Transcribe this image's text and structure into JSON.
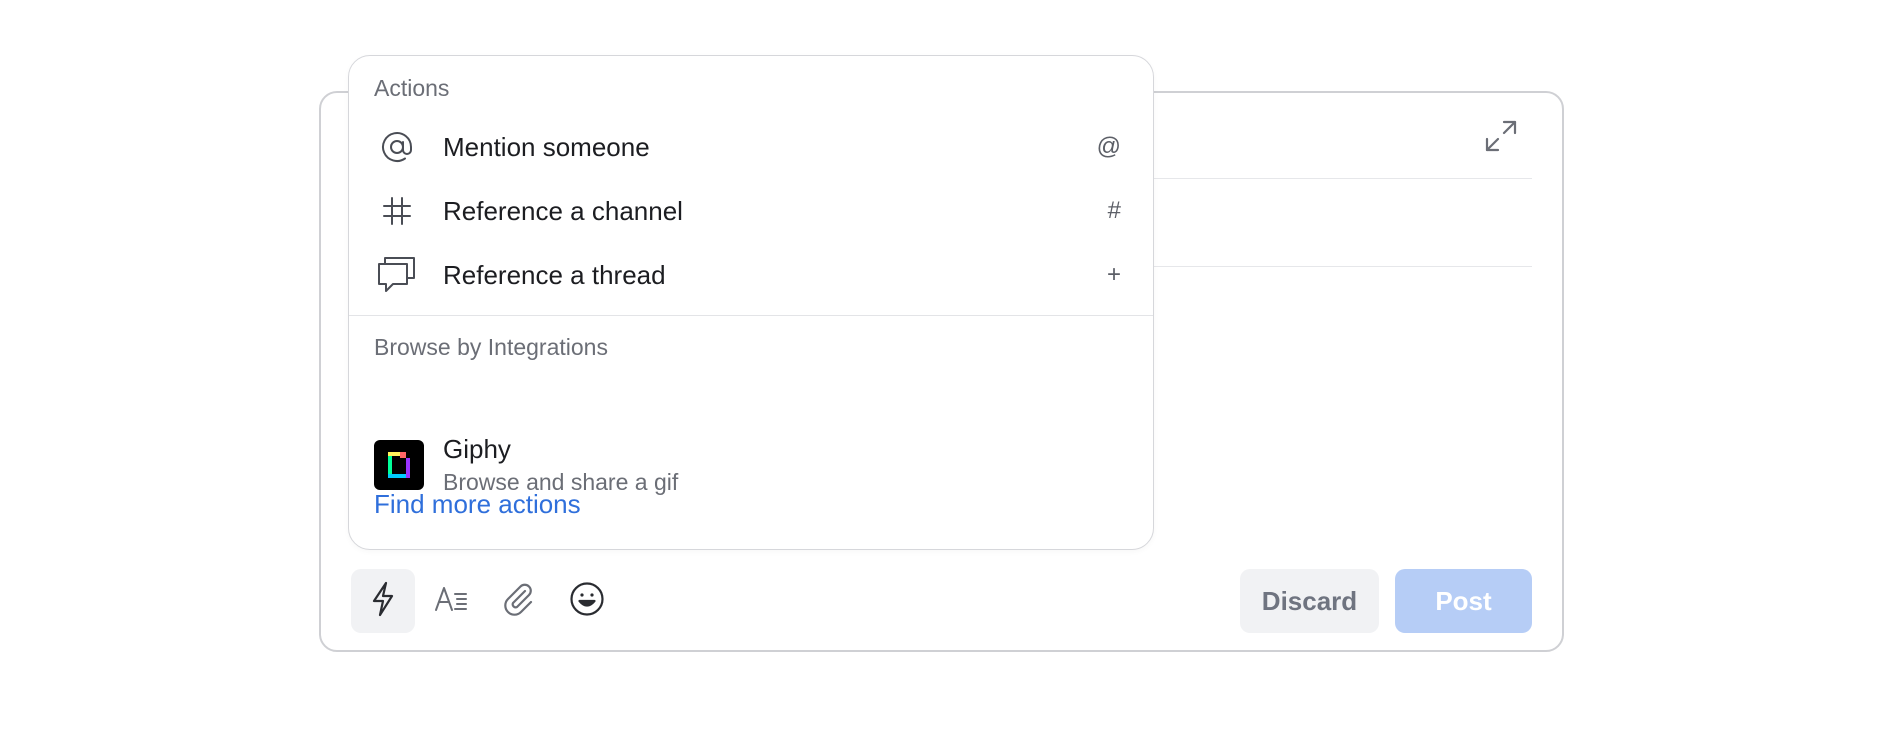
{
  "popover": {
    "actions_title": "Actions",
    "items": [
      {
        "label": "Mention someone",
        "shortcut": "@",
        "icon": "at-icon"
      },
      {
        "label": "Reference a channel",
        "shortcut": "#",
        "icon": "hash-icon"
      },
      {
        "label": "Reference a thread",
        "shortcut": "+",
        "icon": "thread-icon"
      }
    ],
    "integrations_title": "Browse by Integrations",
    "integration": {
      "name": "Giphy",
      "description": "Browse and share a gif",
      "icon": "giphy-logo"
    },
    "find_more": "Find more actions"
  },
  "toolbar": {
    "icons": [
      "lightning-icon",
      "text-format-icon",
      "paperclip-icon",
      "emoji-icon"
    ],
    "discard_label": "Discard",
    "post_label": "Post"
  },
  "colors": {
    "link": "#2f6fdb",
    "post_disabled": "#b6cdf6",
    "discard_bg": "#f1f2f4"
  }
}
